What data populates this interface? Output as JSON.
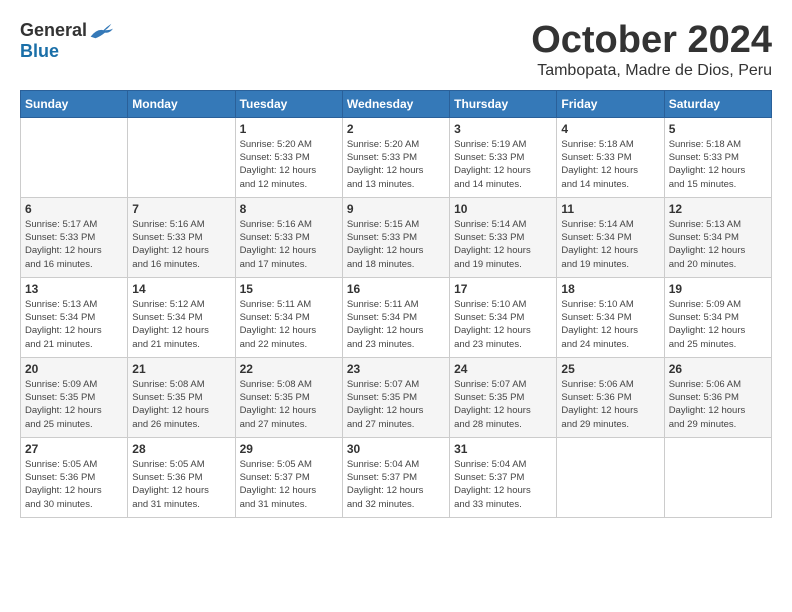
{
  "logo": {
    "general": "General",
    "blue": "Blue"
  },
  "title": {
    "month": "October 2024",
    "location": "Tambopata, Madre de Dios, Peru"
  },
  "weekdays": [
    "Sunday",
    "Monday",
    "Tuesday",
    "Wednesday",
    "Thursday",
    "Friday",
    "Saturday"
  ],
  "weeks": [
    [
      {
        "day": "",
        "info": ""
      },
      {
        "day": "",
        "info": ""
      },
      {
        "day": "1",
        "info": "Sunrise: 5:20 AM\nSunset: 5:33 PM\nDaylight: 12 hours\nand 12 minutes."
      },
      {
        "day": "2",
        "info": "Sunrise: 5:20 AM\nSunset: 5:33 PM\nDaylight: 12 hours\nand 13 minutes."
      },
      {
        "day": "3",
        "info": "Sunrise: 5:19 AM\nSunset: 5:33 PM\nDaylight: 12 hours\nand 14 minutes."
      },
      {
        "day": "4",
        "info": "Sunrise: 5:18 AM\nSunset: 5:33 PM\nDaylight: 12 hours\nand 14 minutes."
      },
      {
        "day": "5",
        "info": "Sunrise: 5:18 AM\nSunset: 5:33 PM\nDaylight: 12 hours\nand 15 minutes."
      }
    ],
    [
      {
        "day": "6",
        "info": "Sunrise: 5:17 AM\nSunset: 5:33 PM\nDaylight: 12 hours\nand 16 minutes."
      },
      {
        "day": "7",
        "info": "Sunrise: 5:16 AM\nSunset: 5:33 PM\nDaylight: 12 hours\nand 16 minutes."
      },
      {
        "day": "8",
        "info": "Sunrise: 5:16 AM\nSunset: 5:33 PM\nDaylight: 12 hours\nand 17 minutes."
      },
      {
        "day": "9",
        "info": "Sunrise: 5:15 AM\nSunset: 5:33 PM\nDaylight: 12 hours\nand 18 minutes."
      },
      {
        "day": "10",
        "info": "Sunrise: 5:14 AM\nSunset: 5:33 PM\nDaylight: 12 hours\nand 19 minutes."
      },
      {
        "day": "11",
        "info": "Sunrise: 5:14 AM\nSunset: 5:34 PM\nDaylight: 12 hours\nand 19 minutes."
      },
      {
        "day": "12",
        "info": "Sunrise: 5:13 AM\nSunset: 5:34 PM\nDaylight: 12 hours\nand 20 minutes."
      }
    ],
    [
      {
        "day": "13",
        "info": "Sunrise: 5:13 AM\nSunset: 5:34 PM\nDaylight: 12 hours\nand 21 minutes."
      },
      {
        "day": "14",
        "info": "Sunrise: 5:12 AM\nSunset: 5:34 PM\nDaylight: 12 hours\nand 21 minutes."
      },
      {
        "day": "15",
        "info": "Sunrise: 5:11 AM\nSunset: 5:34 PM\nDaylight: 12 hours\nand 22 minutes."
      },
      {
        "day": "16",
        "info": "Sunrise: 5:11 AM\nSunset: 5:34 PM\nDaylight: 12 hours\nand 23 minutes."
      },
      {
        "day": "17",
        "info": "Sunrise: 5:10 AM\nSunset: 5:34 PM\nDaylight: 12 hours\nand 23 minutes."
      },
      {
        "day": "18",
        "info": "Sunrise: 5:10 AM\nSunset: 5:34 PM\nDaylight: 12 hours\nand 24 minutes."
      },
      {
        "day": "19",
        "info": "Sunrise: 5:09 AM\nSunset: 5:34 PM\nDaylight: 12 hours\nand 25 minutes."
      }
    ],
    [
      {
        "day": "20",
        "info": "Sunrise: 5:09 AM\nSunset: 5:35 PM\nDaylight: 12 hours\nand 25 minutes."
      },
      {
        "day": "21",
        "info": "Sunrise: 5:08 AM\nSunset: 5:35 PM\nDaylight: 12 hours\nand 26 minutes."
      },
      {
        "day": "22",
        "info": "Sunrise: 5:08 AM\nSunset: 5:35 PM\nDaylight: 12 hours\nand 27 minutes."
      },
      {
        "day": "23",
        "info": "Sunrise: 5:07 AM\nSunset: 5:35 PM\nDaylight: 12 hours\nand 27 minutes."
      },
      {
        "day": "24",
        "info": "Sunrise: 5:07 AM\nSunset: 5:35 PM\nDaylight: 12 hours\nand 28 minutes."
      },
      {
        "day": "25",
        "info": "Sunrise: 5:06 AM\nSunset: 5:36 PM\nDaylight: 12 hours\nand 29 minutes."
      },
      {
        "day": "26",
        "info": "Sunrise: 5:06 AM\nSunset: 5:36 PM\nDaylight: 12 hours\nand 29 minutes."
      }
    ],
    [
      {
        "day": "27",
        "info": "Sunrise: 5:05 AM\nSunset: 5:36 PM\nDaylight: 12 hours\nand 30 minutes."
      },
      {
        "day": "28",
        "info": "Sunrise: 5:05 AM\nSunset: 5:36 PM\nDaylight: 12 hours\nand 31 minutes."
      },
      {
        "day": "29",
        "info": "Sunrise: 5:05 AM\nSunset: 5:37 PM\nDaylight: 12 hours\nand 31 minutes."
      },
      {
        "day": "30",
        "info": "Sunrise: 5:04 AM\nSunset: 5:37 PM\nDaylight: 12 hours\nand 32 minutes."
      },
      {
        "day": "31",
        "info": "Sunrise: 5:04 AM\nSunset: 5:37 PM\nDaylight: 12 hours\nand 33 minutes."
      },
      {
        "day": "",
        "info": ""
      },
      {
        "day": "",
        "info": ""
      }
    ]
  ]
}
